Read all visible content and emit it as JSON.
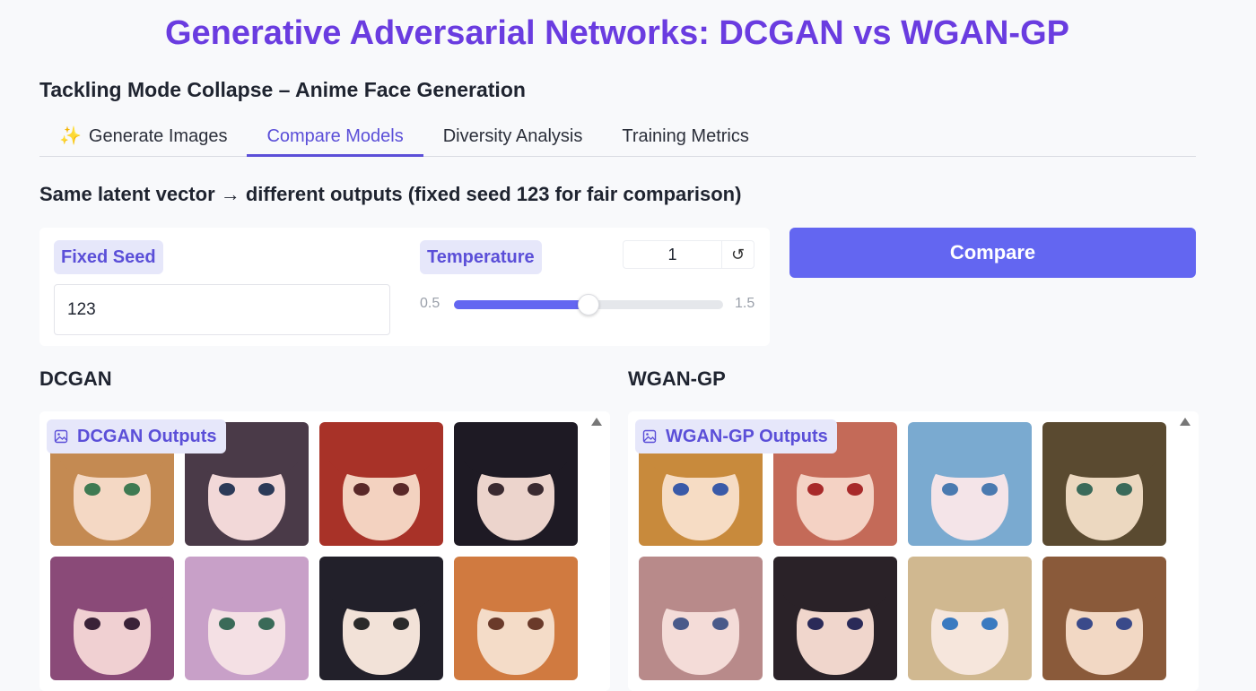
{
  "app": {
    "title": "Generative Adversarial Networks: DCGAN vs WGAN-GP",
    "subtitle": "Tackling Mode Collapse – Anime Face Generation"
  },
  "tabs": [
    {
      "label": "Generate Images",
      "icon": "sparkles-icon",
      "active": false
    },
    {
      "label": "Compare Models",
      "active": true
    },
    {
      "label": "Diversity Analysis",
      "active": false
    },
    {
      "label": "Training Metrics",
      "active": false
    }
  ],
  "compare": {
    "heading": "Same latent vector → different outputs (fixed seed 123 for fair comparison)",
    "seed_label": "Fixed Seed",
    "seed_value": "123",
    "temperature_label": "Temperature",
    "temperature_value": "1",
    "reset_icon": "reset-icon",
    "slider_min": "0.5",
    "slider_max": "1.5",
    "slider_min_value": 0.5,
    "slider_max_value": 1.5,
    "slider_value": 1.0,
    "button_label": "Compare"
  },
  "models": {
    "dcgan": {
      "heading": "DCGAN",
      "gallery_label": "DCGAN Outputs",
      "images": [
        {
          "hair": "#c48a52",
          "skin": "#f4d8c4",
          "eye": "#3f7a52"
        },
        {
          "hair": "#4a3a48",
          "skin": "#f2d8d8",
          "eye": "#2c3a58"
        },
        {
          "hair": "#a83228",
          "skin": "#f3d2c0",
          "eye": "#5a2828"
        },
        {
          "hair": "#1e1a24",
          "skin": "#ecd4cc",
          "eye": "#3a2a30"
        },
        {
          "hair": "#8a4a78",
          "skin": "#f0d0d2",
          "eye": "#3a2238"
        },
        {
          "hair": "#c8a0c8",
          "skin": "#f4e0e4",
          "eye": "#3a6a58"
        },
        {
          "hair": "#22202a",
          "skin": "#f2e2d8",
          "eye": "#2a2a2a"
        },
        {
          "hair": "#d07a40",
          "skin": "#f4dcc8",
          "eye": "#6a3a2a"
        }
      ]
    },
    "wgan": {
      "heading": "WGAN-GP",
      "gallery_label": "WGAN-GP Outputs",
      "images": [
        {
          "hair": "#c88a3c",
          "skin": "#f6dcc4",
          "eye": "#3a5aa8"
        },
        {
          "hair": "#c46a58",
          "skin": "#f4d2c4",
          "eye": "#a82a2a"
        },
        {
          "hair": "#7aaad0",
          "skin": "#f4e4e8",
          "eye": "#4a7ab0"
        },
        {
          "hair": "#5a4a30",
          "skin": "#ecd8c0",
          "eye": "#3a6a5a"
        },
        {
          "hair": "#b88a8a",
          "skin": "#f4dcd8",
          "eye": "#4a5a8a"
        },
        {
          "hair": "#2a2228",
          "skin": "#f0d6cc",
          "eye": "#2a2a58"
        },
        {
          "hair": "#d0b890",
          "skin": "#f6e6dc",
          "eye": "#3a7ac0"
        },
        {
          "hair": "#8a5a3a",
          "skin": "#f2d8c4",
          "eye": "#3a4a8a"
        }
      ]
    }
  },
  "colors": {
    "accent": "#6366f1",
    "title": "#6a3ce0",
    "chip_bg": "#e6e7fa",
    "chip_text": "#5b4fd8"
  }
}
